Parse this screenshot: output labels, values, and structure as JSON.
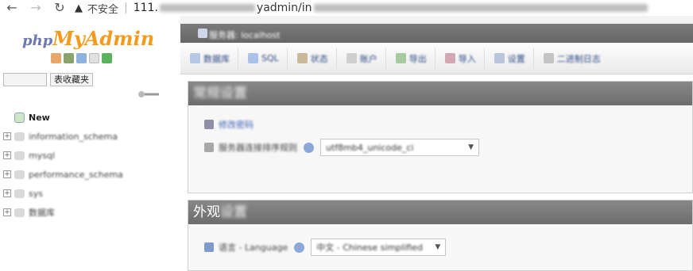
{
  "browser": {
    "back_glyph": "←",
    "forward_glyph": "→",
    "reload_glyph": "↻",
    "warn_glyph": "▲",
    "insecure_label": "不安全",
    "url_host": "111.",
    "url_path_visible": "yadmin/in"
  },
  "sidebar": {
    "logo_php": "php",
    "logo_myadmin": "MyAdmin",
    "recent_button": "",
    "favorites_button": "表收藏夹",
    "tree": [
      {
        "label": "New",
        "type": "new"
      },
      {
        "label": "information_schema",
        "type": "db"
      },
      {
        "label": "mysql",
        "type": "db"
      },
      {
        "label": "performance_schema",
        "type": "db"
      },
      {
        "label": "sys",
        "type": "db"
      },
      {
        "label": "数据库",
        "type": "db"
      }
    ]
  },
  "main": {
    "breadcrumb": "服务器: localhost",
    "tabs": [
      {
        "label": "数据库",
        "icon_color": "#b7c7e6"
      },
      {
        "label": "SQL",
        "icon_color": "#a9c2e8"
      },
      {
        "label": "状态",
        "icon_color": "#c9b89a"
      },
      {
        "label": "账户",
        "icon_color": "#cfcfcf"
      },
      {
        "label": "导出",
        "icon_color": "#a7c9a0"
      },
      {
        "label": "导入",
        "icon_color": "#d2a7b4"
      },
      {
        "label": "设置",
        "icon_color": "#b9c5db"
      },
      {
        "label": "二进制日志",
        "icon_color": "#c4c4c4"
      }
    ],
    "panel1": {
      "title": "常规设置",
      "link": "修改密码",
      "collation_label": "服务器连接排序规则",
      "collation_value": "utf8mb4_unicode_ci"
    },
    "panel2": {
      "title_visible": "外观",
      "title_blurred": "设置",
      "language_label": "语言 - Language",
      "language_value": "中文 - Chinese simplified"
    }
  },
  "colors": {
    "server_bar": "#6d6d6d",
    "panel_header": "#7b7b7b",
    "logo_php": "#6c78af",
    "logo_myadmin": "#f29b1d",
    "link": "#3a5fb0"
  }
}
